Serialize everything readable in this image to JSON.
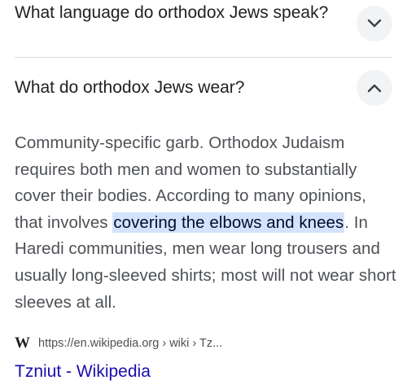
{
  "faq": {
    "q1": {
      "text": "What language do orthodox Jews speak?",
      "expand_icon": "chevron-down-icon"
    },
    "q2": {
      "text": "What do orthodox Jews wear?",
      "collapse_icon": "chevron-up-icon",
      "answer": {
        "before": "Community-specific garb. Orthodox Judaism requires both men and women to substantially cover their bodies. According to many opinions, that involves ",
        "highlight": "covering the elbows and knees",
        "after": ". In Haredi communities, men wear long trousers and usually long-sleeved shirts; most will not wear short sleeves at all."
      },
      "source": {
        "logo": "W",
        "url": "https://en.wikipedia.org › wiki › Tz...",
        "title": "Tzniut - Wikipedia"
      }
    }
  },
  "colors": {
    "link": "#1a0dab",
    "highlight": "#d3e3fd",
    "button_bg": "#f1f3f4",
    "text": "#202124",
    "muted_text": "#4d5156"
  }
}
